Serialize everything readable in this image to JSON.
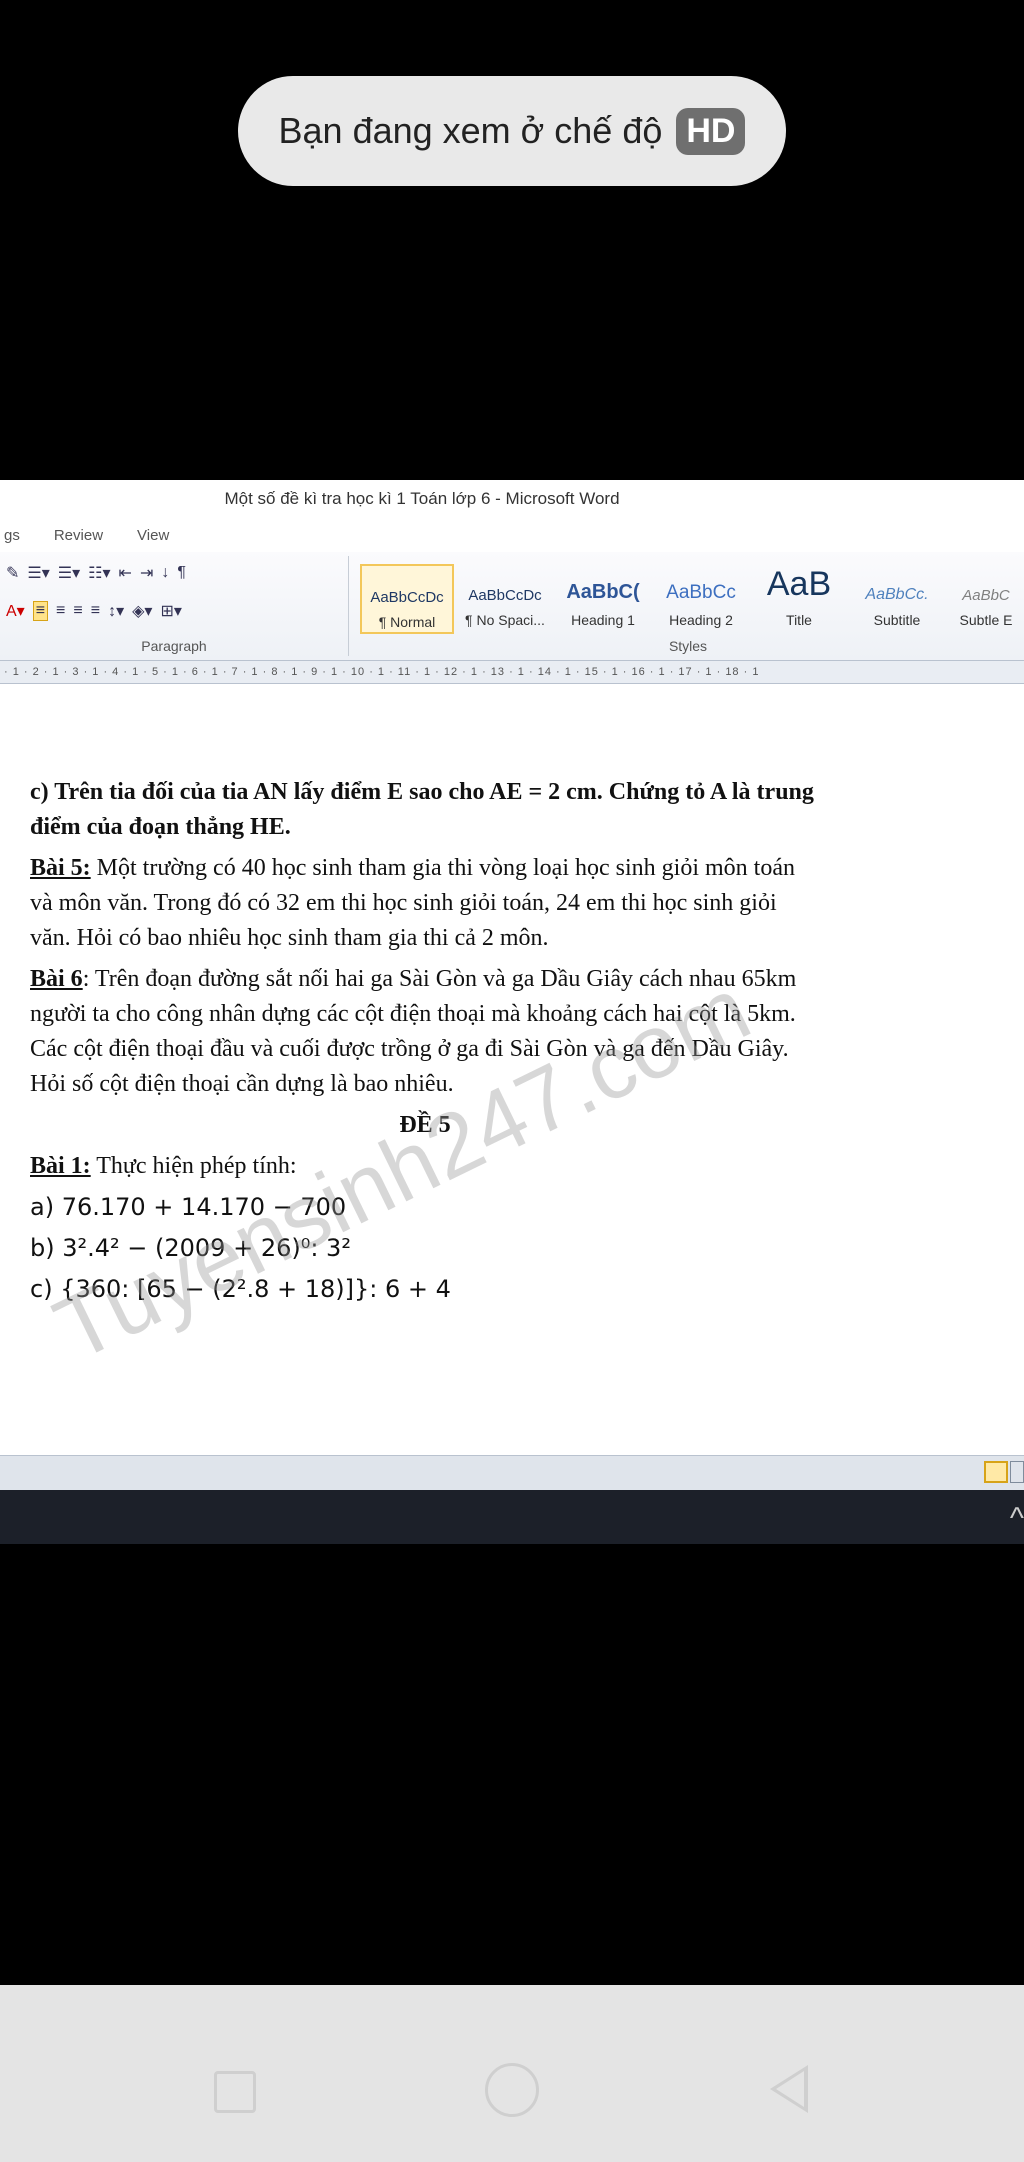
{
  "toast": {
    "text": "Bạn đang xem ở chế độ",
    "badge": "HD"
  },
  "word": {
    "title": "Một số đề kì tra học kì 1 Toán lớp 6  -  Microsoft Word",
    "tabs": [
      "gs",
      "Review",
      "View"
    ],
    "paragraph_label": "Paragraph",
    "styles_label": "Styles",
    "styles": [
      {
        "sample": "AaBbCcDc",
        "name": "¶ Normal"
      },
      {
        "sample": "AaBbCcDc",
        "name": "¶ No Spaci..."
      },
      {
        "sample": "AaBbC(",
        "name": "Heading 1"
      },
      {
        "sample": "AaBbCc",
        "name": "Heading 2"
      },
      {
        "sample": "AaB",
        "name": "Title"
      },
      {
        "sample": "AaBbCc.",
        "name": "Subtitle"
      },
      {
        "sample": "AaBbC",
        "name": "Subtle E"
      }
    ],
    "ruler": "· 1 · 2 · 1 · 3 · 1 · 4 · 1 · 5 · 1 · 6 · 1 · 7 · 1 · 8 · 1 · 9 · 1 · 10 · 1 · 11 · 1 · 12 · 1 · 13 · 1 · 14 · 1 · 15 · 1 · 16 · 1 · 17 · 1 · 18 · 1"
  },
  "document": {
    "para_c": "c) Trên tia đối của tia AN lấy điểm E sao cho AE = 2 cm. Chứng tỏ A là trung điểm của đoạn thẳng HE.",
    "bai5_label": "Bài 5:",
    "bai5_text": " Một trường có 40 học sinh tham gia thi vòng loại học sinh giỏi môn toán và môn văn. Trong đó có 32 em thi học sinh giỏi toán, 24 em thi học sinh giỏi văn. Hỏi có bao nhiêu học sinh tham gia thi cả 2 môn.",
    "bai6_label": "Bài 6",
    "bai6_text": ": Trên đoạn đường sắt nối hai ga Sài Gòn và ga Dầu Giây cách nhau 65km người ta cho công nhân dựng các cột điện thoại mà khoảng cách hai cột là 5km. Các cột điện thoại đầu và cuối được trồng ở ga đi Sài Gòn và ga đến Dầu Giây. Hỏi số cột điện thoại cần dựng là bao nhiêu.",
    "de5": "ĐỀ 5",
    "bai1_label": "Bài 1:",
    "bai1_text": " Thực hiện phép tính:",
    "line_a": "a) 76.170 + 14.170 − 700",
    "line_b": "b) 3².4² − (2009 + 26)⁰: 3²",
    "line_c": "c) {360: [65 − (2².8 + 18)]}: 6 + 4",
    "watermark": "Tuyensinh247.com"
  }
}
